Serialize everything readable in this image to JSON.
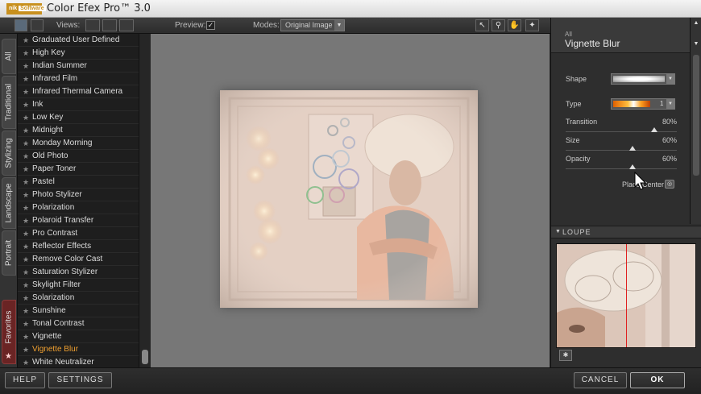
{
  "app": {
    "title": "Color Efex Pro™ 3.0",
    "logo_text": "nik",
    "logo_sub": "Software"
  },
  "toolbar": {
    "views_label": "Views:",
    "preview_label": "Preview:",
    "preview_checked": "✓",
    "modes_label": "Modes:",
    "mode_value": "Original Image"
  },
  "tabs": [
    {
      "label": "All"
    },
    {
      "label": "Traditional"
    },
    {
      "label": "Stylizing"
    },
    {
      "label": "Landscape"
    },
    {
      "label": "Portrait"
    },
    {
      "label": "Favorites"
    }
  ],
  "filters": [
    "Graduated User Defined",
    "High Key",
    "Indian Summer",
    "Infrared Film",
    "Infrared Thermal Camera",
    "Ink",
    "Low Key",
    "Midnight",
    "Monday Morning",
    "Old Photo",
    "Paper Toner",
    "Pastel",
    "Photo Stylizer",
    "Polarization",
    "Polaroid Transfer",
    "Pro Contrast",
    "Reflector Effects",
    "Remove Color Cast",
    "Saturation Stylizer",
    "Skylight Filter",
    "Solarization",
    "Sunshine",
    "Tonal Contrast",
    "Vignette",
    "Vignette Blur",
    "White Neutralizer"
  ],
  "active_filter": "Vignette Blur",
  "panel": {
    "category": "All",
    "title": "Vignette Blur",
    "shape_label": "Shape",
    "type_label": "Type",
    "type_value": "1",
    "transition_label": "Transition",
    "transition_value": "80%",
    "transition_level": 80,
    "size_label": "Size",
    "size_value": "60%",
    "size_level": 60,
    "opacity_label": "Opacity",
    "opacity_value": "60%",
    "opacity_level": 60,
    "place_center_label": "Place Center"
  },
  "loupe": {
    "title": "LOUPE"
  },
  "bottom": {
    "help": "HELP",
    "settings": "SETTINGS",
    "cancel": "CANCEL",
    "ok": "OK"
  },
  "colors": {
    "active_filter": "#f0a030",
    "favorites_tab": "#6a2424",
    "loupe_line": "#e02020"
  }
}
